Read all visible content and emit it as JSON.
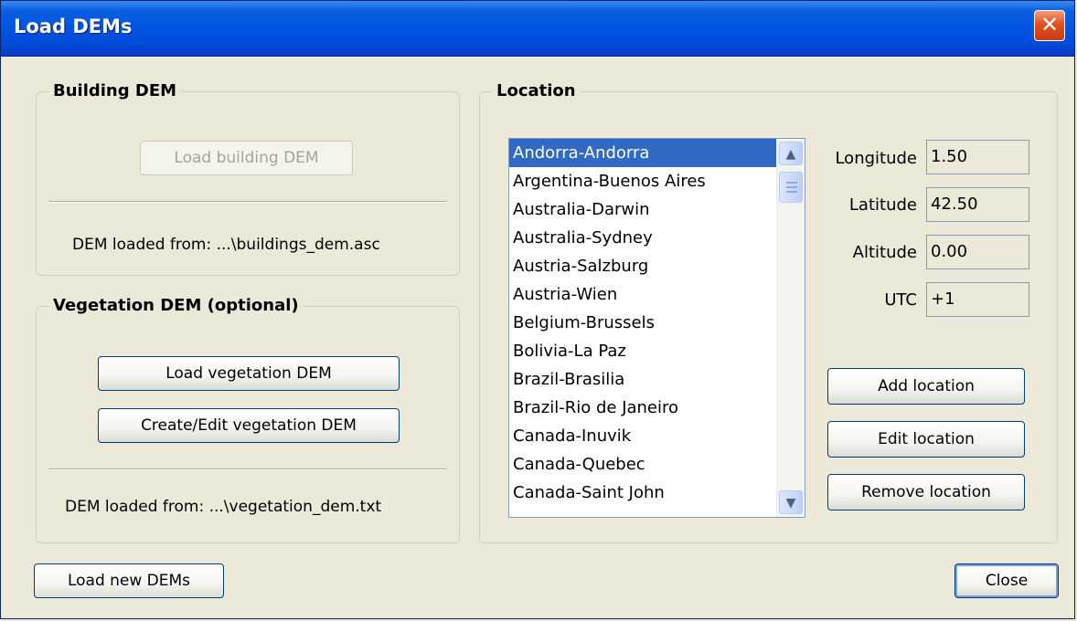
{
  "window": {
    "title": "Load DEMs",
    "close_glyph": "✕"
  },
  "building": {
    "group_title": "Building DEM",
    "load_button": "Load building DEM",
    "status": "DEM loaded from: ...\\buildings_dem.asc"
  },
  "vegetation": {
    "group_title": "Vegetation DEM (optional)",
    "load_button": "Load vegetation DEM",
    "edit_button": "Create/Edit vegetation DEM",
    "status": "DEM loaded from: ...\\vegetation_dem.txt"
  },
  "location": {
    "group_title": "Location",
    "items": [
      "Andorra-Andorra",
      "Argentina-Buenos Aires",
      "Australia-Darwin",
      "Australia-Sydney",
      "Austria-Salzburg",
      "Austria-Wien",
      "Belgium-Brussels",
      "Bolivia-La Paz",
      "Brazil-Brasilia",
      "Brazil-Rio de Janeiro",
      "Canada-Inuvik",
      "Canada-Quebec",
      "Canada-Saint John"
    ],
    "selected_index": 0,
    "fields": {
      "longitude_label": "Longitude",
      "longitude_value": "1.50",
      "latitude_label": "Latitude",
      "latitude_value": "42.50",
      "altitude_label": "Altitude",
      "altitude_value": "0.00",
      "utc_label": "UTC",
      "utc_value": "+1"
    },
    "add_button": "Add location",
    "edit_button": "Edit location",
    "remove_button": "Remove location"
  },
  "footer": {
    "load_new_button": "Load new DEMs",
    "close_button": "Close"
  },
  "icons": {
    "scroll_up": "▲",
    "scroll_down": "▼"
  }
}
